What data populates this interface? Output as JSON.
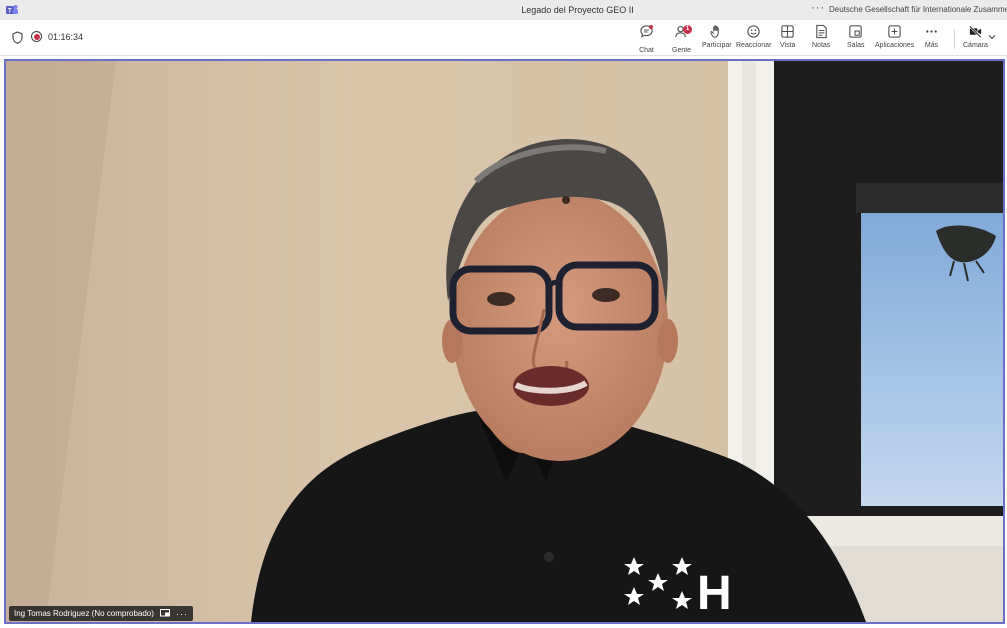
{
  "window": {
    "title": "Legado del Proyecto GEO II",
    "more_label": "···",
    "org_name": "Deutsche Gesellschaft für Internationale Zusammenarbe"
  },
  "meeting": {
    "timer": "01:16:34",
    "people_badge": "1"
  },
  "toolbar": {
    "chat": "Chat",
    "people": "Gente",
    "raise": "Participar",
    "react": "Reaccionar",
    "view": "Vista",
    "notes": "Notas",
    "rooms": "Salas",
    "apps": "Aplicaciones",
    "more": "Más",
    "camera": "Cámara"
  },
  "participant": {
    "name": "Ing Tomas Rodriguez (No comprobado)",
    "more": "···"
  },
  "shirt_letter": "H",
  "colors": {
    "accent": "#6b6fc7",
    "badge": "#c4314b",
    "titlebar": "#ebebeb"
  }
}
